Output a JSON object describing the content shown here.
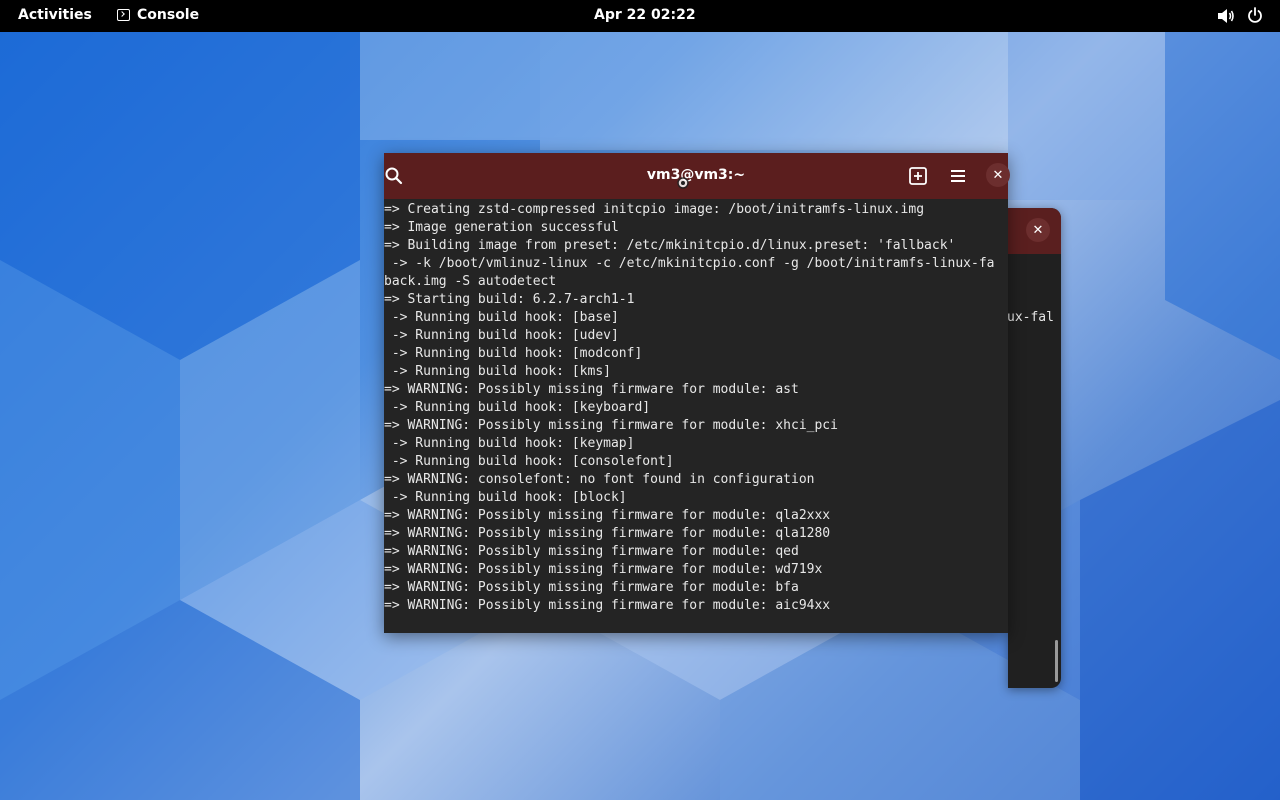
{
  "topbar": {
    "activities_label": "Activities",
    "app_name": "Console",
    "clock": "Apr 22  02:22",
    "volume_icon": "volume-icon",
    "power_icon": "power-icon"
  },
  "colors": {
    "titlebar": "#5b1e1e",
    "terminal_bg": "#242424",
    "terminal_text": "#e8e8e8",
    "topbar_bg": "#000000"
  },
  "window": {
    "title": "vm3@vm3:~",
    "search_icon": "search-icon",
    "new_tab_icon": "new-tab-icon",
    "menu_icon": "hamburger-menu-icon",
    "close_label": "✕",
    "lines": [
      "=> Creating zstd-compressed initcpio image: /boot/initramfs-linux.img",
      "=> Image generation successful",
      "=> Building image from preset: /etc/mkinitcpio.d/linux.preset: 'fallback'",
      " -> -k /boot/vmlinuz-linux -c /etc/mkinitcpio.conf -g /boot/initramfs-linux-fa",
      "back.img -S autodetect",
      "=> Starting build: 6.2.7-arch1-1",
      " -> Running build hook: [base]",
      " -> Running build hook: [udev]",
      " -> Running build hook: [modconf]",
      " -> Running build hook: [kms]",
      "=> WARNING: Possibly missing firmware for module: ast",
      " -> Running build hook: [keyboard]",
      "=> WARNING: Possibly missing firmware for module: xhci_pci",
      " -> Running build hook: [keymap]",
      " -> Running build hook: [consolefont]",
      "=> WARNING: consolefont: no font found in configuration",
      " -> Running build hook: [block]",
      "=> WARNING: Possibly missing firmware for module: qla2xxx",
      "=> WARNING: Possibly missing firmware for module: qla1280",
      "=> WARNING: Possibly missing firmware for module: qed",
      "=> WARNING: Possibly missing firmware for module: wd719x",
      "=> WARNING: Possibly missing firmware for module: bfa",
      "=> WARNING: Possibly missing firmware for module: aic94xx"
    ]
  },
  "back_window": {
    "close_label": "✕",
    "visible_text": "ux-fal"
  }
}
